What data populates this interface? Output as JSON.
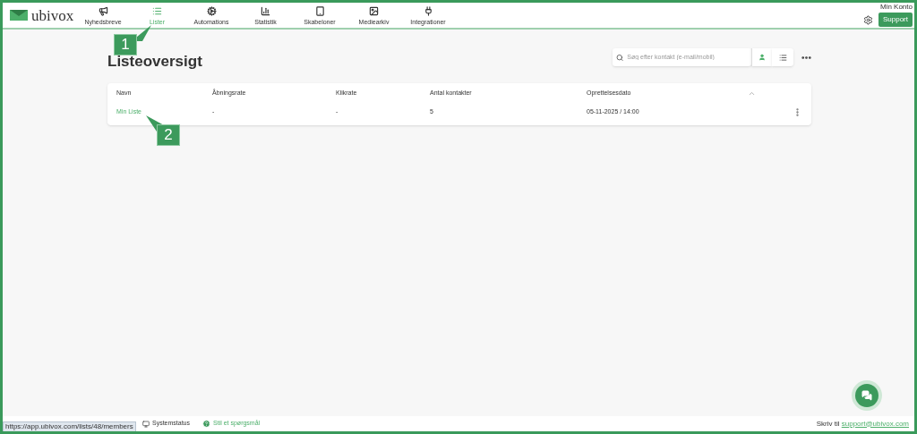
{
  "header": {
    "logo": "ubivox",
    "account": "Min Konto",
    "support_button": "Support"
  },
  "nav": [
    {
      "label": "Nyhedsbreve",
      "kind": "megaphone",
      "selected": false
    },
    {
      "label": "Lister",
      "kind": "list",
      "selected": true
    },
    {
      "label": "Automations",
      "kind": "gears",
      "selected": false
    },
    {
      "label": "Statistik",
      "kind": "chart",
      "selected": false
    },
    {
      "label": "Skabeloner",
      "kind": "template",
      "selected": false
    },
    {
      "label": "Mediearkiv",
      "kind": "image",
      "selected": false
    },
    {
      "label": "Integrationer",
      "kind": "plug",
      "selected": false
    }
  ],
  "page": {
    "title": "Listeoversigt",
    "search": {
      "placeholder": "Søg efter kontakt (e-mail/mobil)"
    }
  },
  "table": {
    "columns": [
      "Navn",
      "Åbningsrate",
      "Klikrate",
      "Antal kontakter",
      "Oprettelsesdato"
    ],
    "rows": [
      {
        "cells": [
          "Min Liste",
          "-",
          "-",
          "5",
          "05-11-2025 / 14:00"
        ]
      }
    ]
  },
  "callouts": [
    "1",
    "2"
  ],
  "footer": {
    "links": [
      "Systemstatus",
      "Stil et spørgsmål"
    ],
    "write_to": "Skriv til",
    "email": "support@ubivox.com"
  },
  "status_url": "https://app.ubivox.com/lists/48/members"
}
